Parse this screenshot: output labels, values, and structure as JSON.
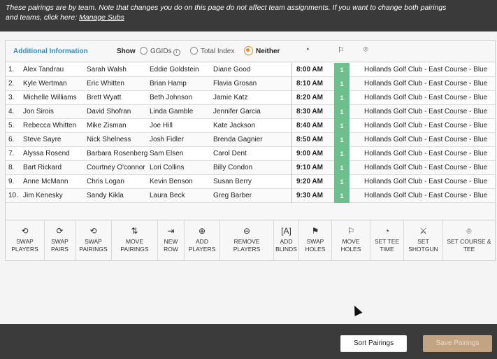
{
  "banner": {
    "text": "These pairings are by team. Note that changes you do on this page do not affect team assignments. If you want to change both pairings and teams, click here:",
    "link": "Manage Subs"
  },
  "header": {
    "title": "Additional Information",
    "show_label": "Show",
    "options": [
      {
        "label": "GGIDs",
        "selected": false
      },
      {
        "label": "Total Index",
        "selected": false
      },
      {
        "label": "Neither",
        "selected": true
      }
    ],
    "icons": [
      "clock-icon",
      "flag-icon",
      "location-icon"
    ]
  },
  "rows": [
    {
      "num": "1.",
      "p1": "Alex Tandrau",
      "p2": "Sarah Walsh",
      "p3": "Eddie Goldstein",
      "p4": "Diane Good",
      "time": "8:00 AM",
      "hole": "1",
      "course": "Hollands Golf Club - East Course - Blue"
    },
    {
      "num": "2.",
      "p1": "Kyle Wertman",
      "p2": "Eric Whitten",
      "p3": "Brian Hamp",
      "p4": "Flavia Grosan",
      "time": "8:10 AM",
      "hole": "1",
      "course": "Hollands Golf Club - East Course - Blue"
    },
    {
      "num": "3.",
      "p1": "Michelle Williams",
      "p2": "Brett Wyatt",
      "p3": "Beth Johnson",
      "p4": "Jamie Katz",
      "time": "8:20 AM",
      "hole": "1",
      "course": "Hollands Golf Club - East Course - Blue"
    },
    {
      "num": "4.",
      "p1": "Jon Sirois",
      "p2": "David Shofran",
      "p3": "Linda Gamble",
      "p4": "Jennifer Garcia",
      "time": "8:30 AM",
      "hole": "1",
      "course": "Hollands Golf Club - East Course - Blue"
    },
    {
      "num": "5.",
      "p1": "Rebecca Whitten",
      "p2": "Mike Zisman",
      "p3": "Joe Hill",
      "p4": "Kate Jackson",
      "time": "8:40 AM",
      "hole": "1",
      "course": "Hollands Golf Club - East Course - Blue"
    },
    {
      "num": "6.",
      "p1": "Steve Sayre",
      "p2": "Nick Shelness",
      "p3": "Josh Fidler",
      "p4": "Brenda Gagnier",
      "time": "8:50 AM",
      "hole": "1",
      "course": "Hollands Golf Club - East Course - Blue"
    },
    {
      "num": "7.",
      "p1": "Alyssa Rosend",
      "p2": "Barbara Rosenberg",
      "p3": "Sam Elsen",
      "p4": "Carol Dent",
      "time": "9:00 AM",
      "hole": "1",
      "course": "Hollands Golf Club - East Course - Blue"
    },
    {
      "num": "8.",
      "p1": "Bart Rickard",
      "p2": "Courtney O'connor",
      "p3": "Lori Collins",
      "p4": "Billy Condon",
      "time": "9:10 AM",
      "hole": "1",
      "course": "Hollands Golf Club - East Course - Blue"
    },
    {
      "num": "9.",
      "p1": "Anne McMann",
      "p2": "Chris Logan",
      "p3": "Kevin Benson",
      "p4": "Susan Berry",
      "time": "9:20 AM",
      "hole": "1",
      "course": "Hollands Golf Club - East Course - Blue"
    },
    {
      "num": "10.",
      "p1": "Jim Kenesky",
      "p2": "Sandy Kikla",
      "p3": "Laura Beck",
      "p4": "Greg Barber",
      "time": "9:30 AM",
      "hole": "1",
      "course": "Hollands Golf Club - East Course - Blue"
    }
  ],
  "toolbar": [
    {
      "name": "swap-players",
      "icon": "swap-players-icon",
      "line1": "SWAP",
      "line2": "PLAYERS"
    },
    {
      "name": "swap-pairs",
      "icon": "swap-pairs-icon",
      "line1": "SWAP",
      "line2": "PAIRS"
    },
    {
      "name": "swap-pairings",
      "icon": "swap-pairings-icon",
      "line1": "SWAP",
      "line2": "PAIRINGS"
    },
    {
      "name": "move-pairings",
      "icon": "move-pairings-icon",
      "line1": "MOVE",
      "line2": "PAIRINGS"
    },
    {
      "name": "new-row",
      "icon": "new-row-icon",
      "line1": "NEW",
      "line2": "ROW"
    },
    {
      "name": "add-players",
      "icon": "add-players-icon",
      "line1": "ADD",
      "line2": "PLAYERS"
    },
    {
      "name": "remove-players",
      "icon": "remove-players-icon",
      "line1": "REMOVE",
      "line2": "PLAYERS"
    },
    {
      "name": "add-blinds",
      "icon": "add-blinds-icon",
      "line1": "ADD",
      "line2": "BLINDS"
    },
    {
      "name": "swap-holes",
      "icon": "swap-holes-icon",
      "line1": "SWAP",
      "line2": "HOLES"
    },
    {
      "name": "move-holes",
      "icon": "move-holes-icon",
      "line1": "MOVE",
      "line2": "HOLES"
    },
    {
      "name": "set-tee-time",
      "icon": "clock-icon",
      "line1": "SET TEE",
      "line2": "TIME"
    },
    {
      "name": "set-shotgun",
      "icon": "shotgun-icon",
      "line1": "SET",
      "line2": "SHOTGUN"
    },
    {
      "name": "set-course-tee",
      "icon": "location-icon",
      "line1": "SET COURSE &",
      "line2": "TEE"
    }
  ],
  "footer": {
    "sort_label": "Sort Pairings",
    "save_label": "Save Pairings"
  },
  "colors": {
    "accent_blue": "#2c8fc7",
    "hole_green": "#6dbf8b",
    "radio_orange": "#f08a1d",
    "save_disabled": "#c2a483"
  }
}
